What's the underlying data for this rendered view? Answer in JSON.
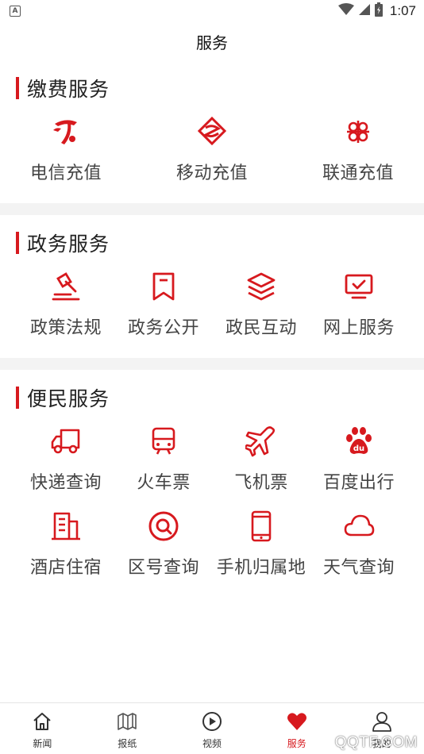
{
  "status": {
    "badge": "A",
    "time": "1:07"
  },
  "header": {
    "title": "服务"
  },
  "colors": {
    "accent": "#d7191e",
    "gap": "#f3f3f3"
  },
  "sections": [
    {
      "title": "缴费服务",
      "items": [
        {
          "label": "电信充值",
          "icon": "china-telecom-icon"
        },
        {
          "label": "移动充值",
          "icon": "china-mobile-icon"
        },
        {
          "label": "联通充值",
          "icon": "china-unicom-icon"
        }
      ]
    },
    {
      "title": "政务服务",
      "items": [
        {
          "label": "政策法规",
          "icon": "gavel-icon"
        },
        {
          "label": "政务公开",
          "icon": "bookmark-icon"
        },
        {
          "label": "政民互动",
          "icon": "layers-icon"
        },
        {
          "label": "网上服务",
          "icon": "monitor-check-icon"
        }
      ]
    },
    {
      "title": "便民服务",
      "items": [
        {
          "label": "快递查询",
          "icon": "truck-icon"
        },
        {
          "label": "火车票",
          "icon": "train-icon"
        },
        {
          "label": "飞机票",
          "icon": "airplane-icon"
        },
        {
          "label": "百度出行",
          "icon": "baidu-icon"
        },
        {
          "label": "酒店住宿",
          "icon": "hotel-building-icon"
        },
        {
          "label": "区号查询",
          "icon": "search-circle-icon"
        },
        {
          "label": "手机归属地",
          "icon": "mobile-phone-icon"
        },
        {
          "label": "天气查询",
          "icon": "cloud-icon"
        }
      ]
    }
  ],
  "tabbar": [
    {
      "label": "新闻",
      "icon": "home-icon",
      "active": false
    },
    {
      "label": "报纸",
      "icon": "map-icon",
      "active": false
    },
    {
      "label": "视频",
      "icon": "play-circle-icon",
      "active": false
    },
    {
      "label": "服务",
      "icon": "heart-icon",
      "active": true
    },
    {
      "label": "我的",
      "icon": "user-icon",
      "active": false
    }
  ],
  "watermark": "QQTF.COM"
}
